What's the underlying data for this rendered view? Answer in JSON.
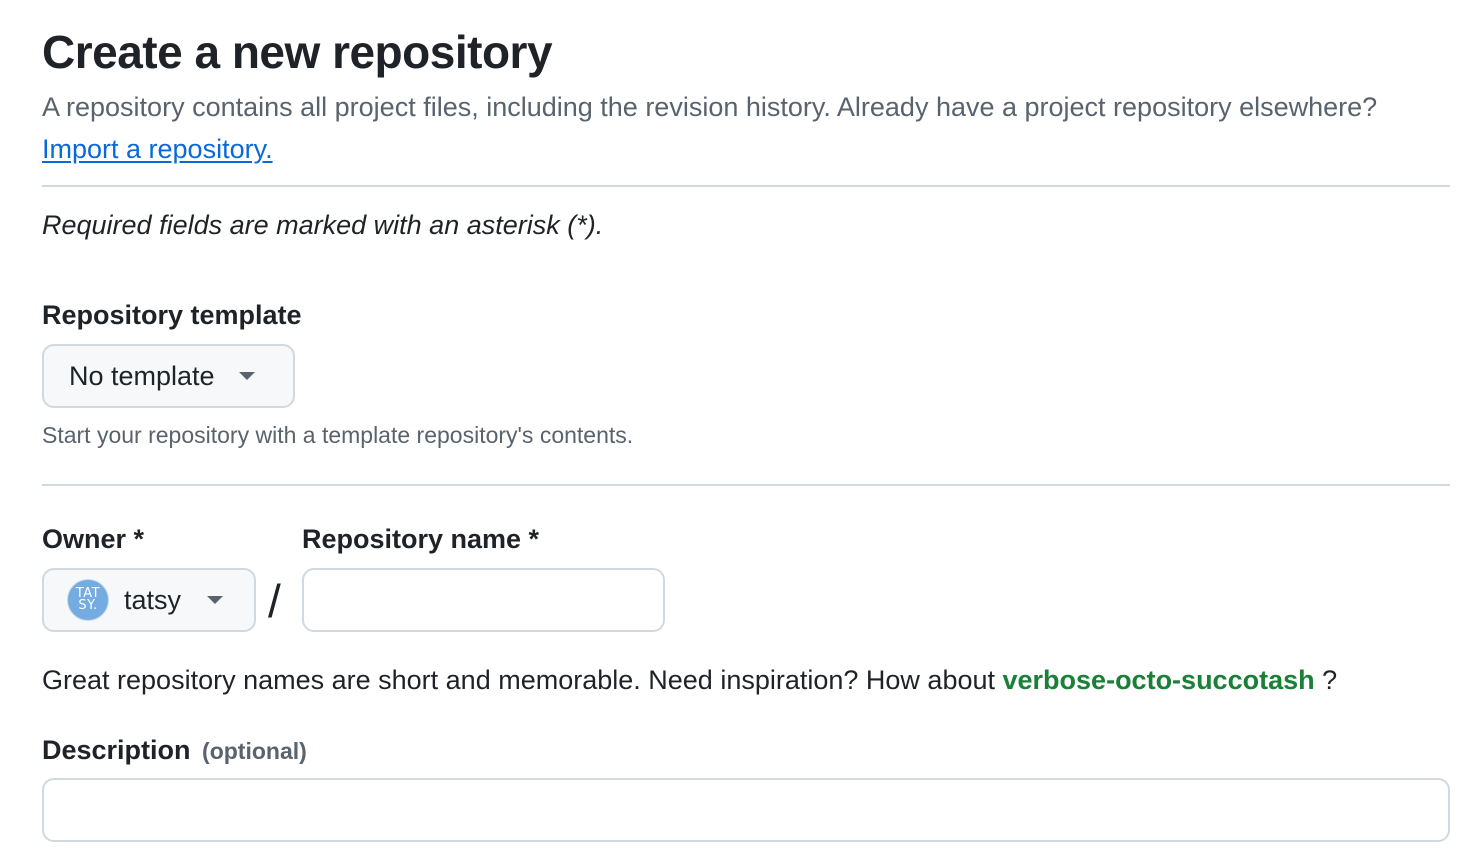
{
  "header": {
    "title": "Create a new repository",
    "intro_text": "A repository contains all project files, including the revision history. Already have a project repository elsewhere?",
    "import_link": "Import a repository."
  },
  "required_note": "Required fields are marked with an asterisk (*).",
  "template": {
    "label": "Repository template",
    "selected": "No template",
    "hint": "Start your repository with a template repository's contents."
  },
  "owner": {
    "label": "Owner *",
    "name": "tatsy",
    "avatar_line1": "TAT",
    "avatar_line2": "SY."
  },
  "separator": "/",
  "repo_name": {
    "label": "Repository name *",
    "value": "",
    "placeholder": ""
  },
  "name_suggestion": {
    "prefix": "Great repository names are short and memorable. Need inspiration? How about",
    "suggested_name": "verbose-octo-succotash",
    "suffix": "?"
  },
  "description": {
    "label": "Description",
    "optional_tag": "(optional)",
    "value": "",
    "placeholder": ""
  },
  "colors": {
    "link": "#0969da",
    "suggestion": "#1a7f37",
    "muted_text": "#59636e",
    "border": "#d1d9e0",
    "button_bg": "#f6f8fa",
    "avatar_bg": "#74abe0"
  },
  "icons": {
    "dropdown": "triangle-down-icon"
  }
}
